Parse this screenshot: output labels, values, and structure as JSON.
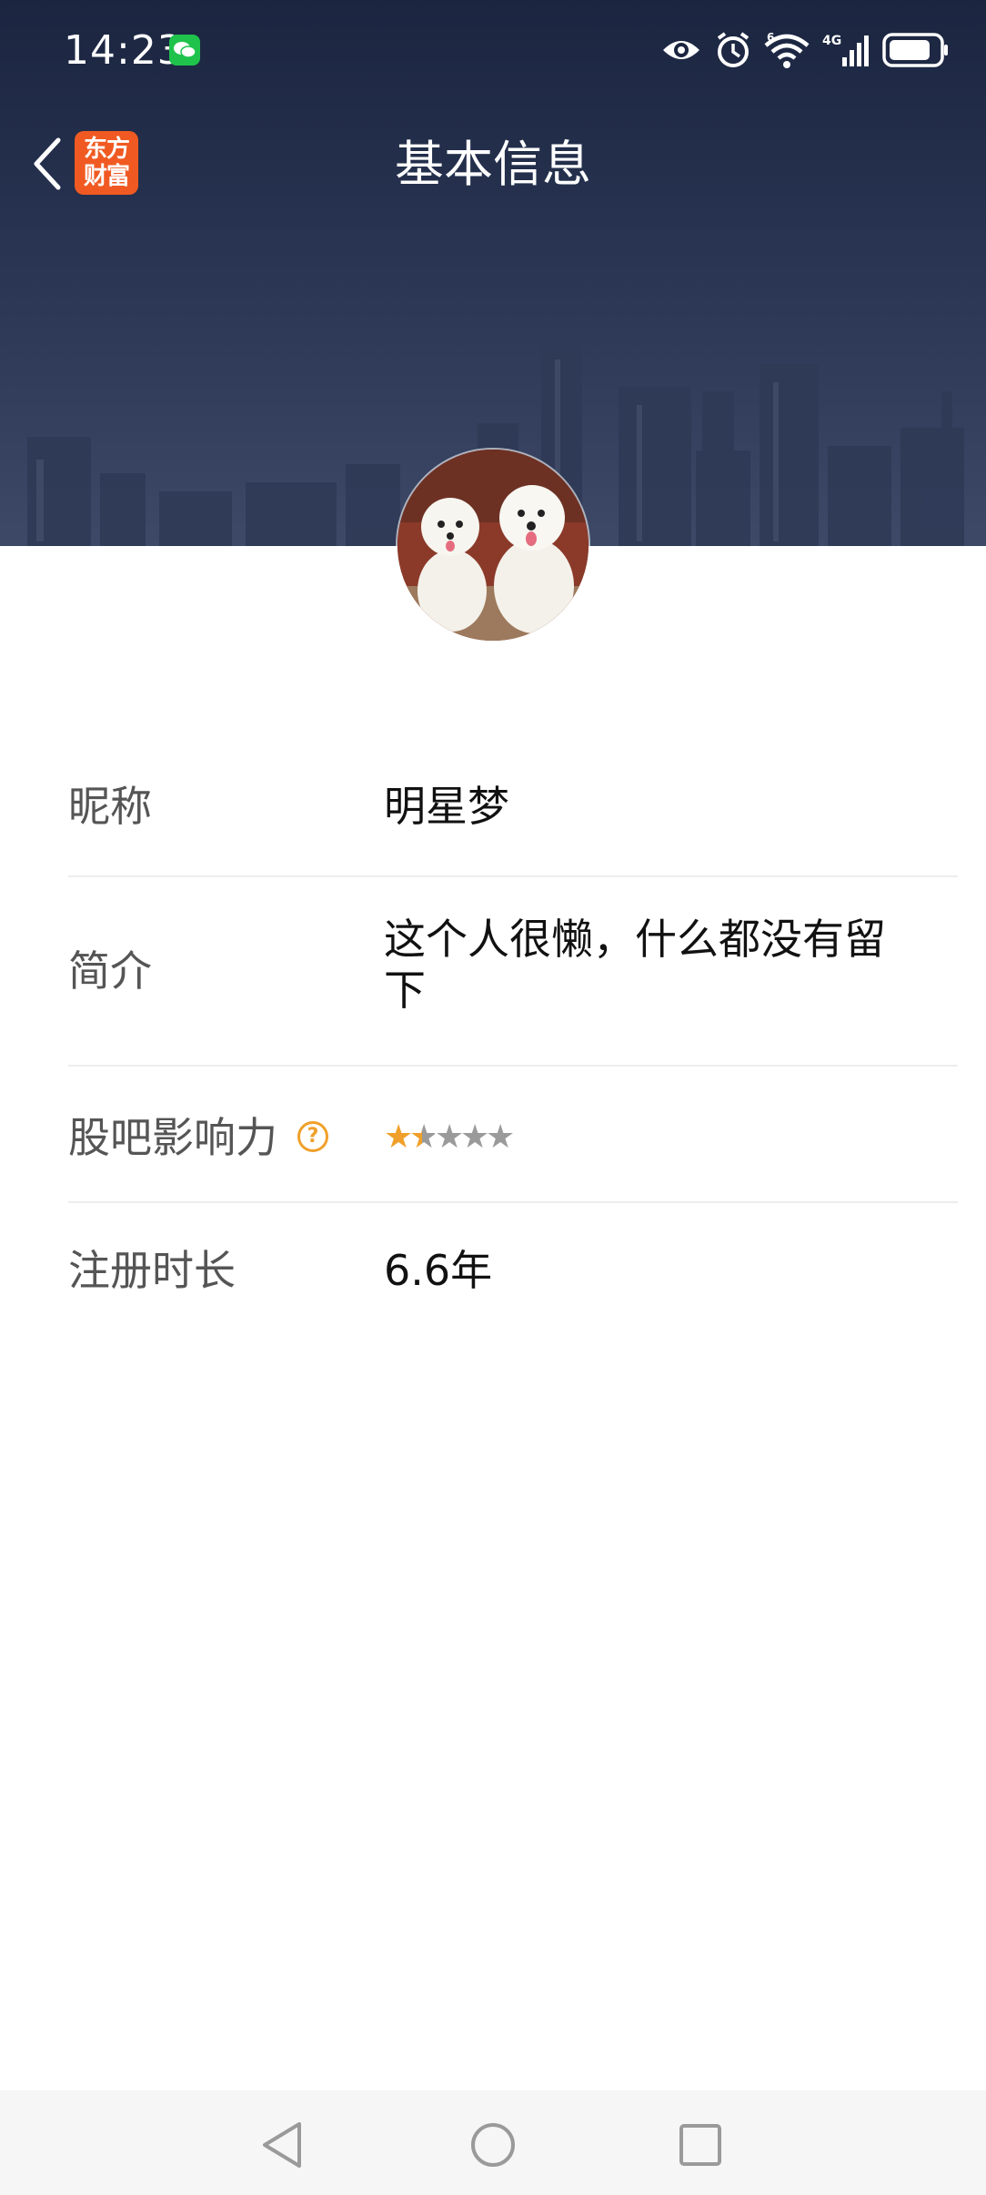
{
  "status_bar": {
    "time": "14:23",
    "icons": [
      "wechat-icon",
      "eye-icon",
      "alarm-icon",
      "wifi-6-icon",
      "4g-signal-icon",
      "battery-icon"
    ],
    "network_label": "4G",
    "wifi_label": "6"
  },
  "header": {
    "title": "基本信息",
    "logo_line1": "东方",
    "logo_line2": "财富"
  },
  "profile": {
    "avatar": "avatar-two-white-dogs"
  },
  "info": {
    "nickname_label": "昵称",
    "nickname_value": "明星梦",
    "bio_label": "简介",
    "bio_value": "这个人很懒，什么都没有留下",
    "influence_label": "股吧影响力",
    "influence_help": "?",
    "influence_rating": 1.5,
    "influence_max": 5,
    "reg_label": "注册时长",
    "reg_value": "6.6年"
  },
  "colors": {
    "header_bg": "#1b2540",
    "star_active": "#f0a02a",
    "star_inactive": "#9a9a9a",
    "logo_bg": "#f05a22"
  }
}
